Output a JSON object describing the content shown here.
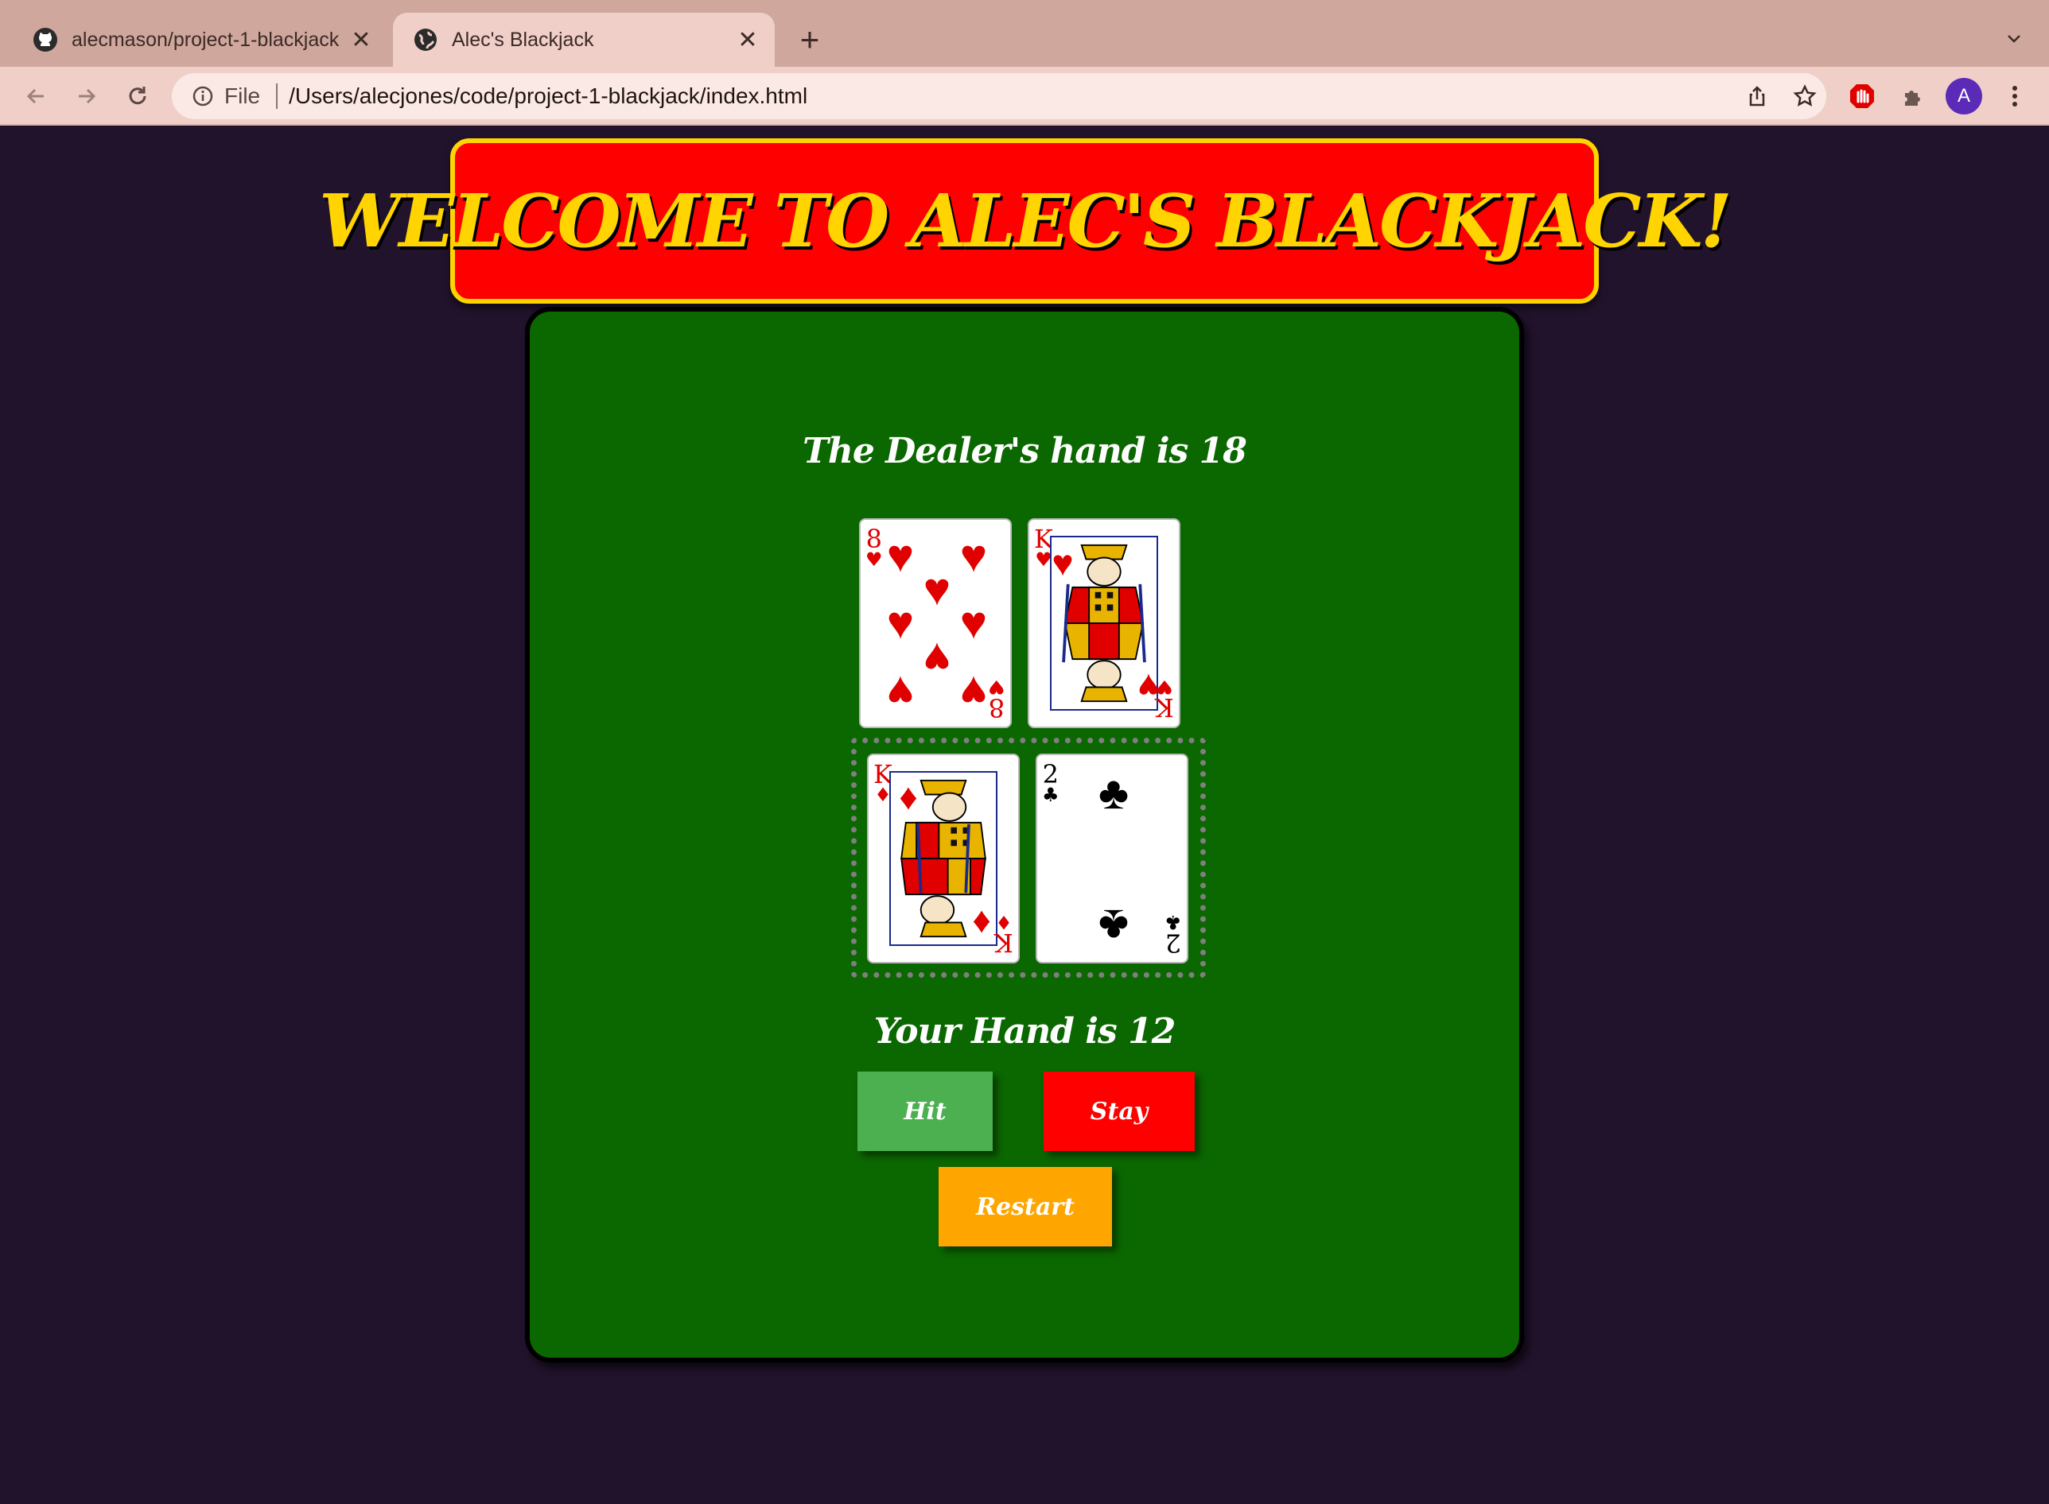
{
  "browser": {
    "tabs": [
      {
        "title": "alecmason/project-1-blackjack",
        "icon": "github-icon",
        "active": false
      },
      {
        "title": "Alec's Blackjack",
        "icon": "globe-icon",
        "active": true
      }
    ],
    "address": {
      "scheme_label": "File",
      "url": "/Users/alecjones/code/project-1-blackjack/index.html"
    },
    "profile_initial": "A"
  },
  "page": {
    "banner_title": "WELCOME TO ALEC'S BLACKJACK!",
    "dealer_label": "The Dealer's hand is 18",
    "player_label": "Your Hand is 12",
    "buttons": {
      "hit": "Hit",
      "stay": "Stay",
      "restart": "Restart"
    },
    "dealer_cards": [
      {
        "rank": "8",
        "suit": "♥",
        "color": "#e00000"
      },
      {
        "rank": "K",
        "suit": "♥",
        "color": "#e00000"
      }
    ],
    "player_cards": [
      {
        "rank": "K",
        "suit": "♦",
        "color": "#e00000"
      },
      {
        "rank": "2",
        "suit": "♣",
        "color": "#000000"
      }
    ]
  },
  "colors": {
    "background": "#22132c",
    "banner": "#fe0000",
    "banner_text": "#ffd400",
    "felt": "#0b6700",
    "hit": "#4caf50",
    "stay": "#fe0000",
    "restart": "#ffa500"
  }
}
